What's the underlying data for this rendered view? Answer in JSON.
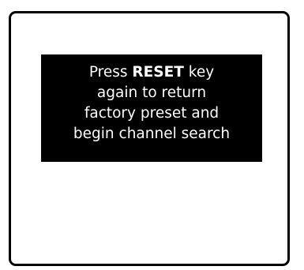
{
  "dialog": {
    "line1_prefix": "Press ",
    "key_name": "RESET",
    "line1_suffix": " key",
    "line2": "again to return",
    "line3": "factory preset and",
    "line4": "begin channel search"
  },
  "colors": {
    "message_background": "#000000",
    "message_text": "#ffffff",
    "screen_background": "#ffffff",
    "frame_border": "#000000"
  }
}
